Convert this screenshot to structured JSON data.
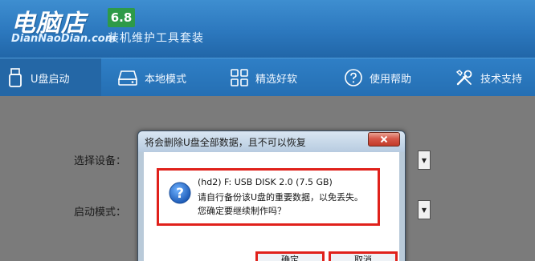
{
  "app": {
    "logo_cn": "电脑店",
    "logo_en": "DianNaoDian.com",
    "version": "6.8",
    "subtitle": "装机维护工具套装"
  },
  "nav": {
    "items": [
      {
        "label": "U盘启动",
        "icon": "usb-drive-icon"
      },
      {
        "label": "本地模式",
        "icon": "hard-disk-icon"
      },
      {
        "label": "精选好软",
        "icon": "grid-apps-icon"
      },
      {
        "label": "使用帮助",
        "icon": "help-circle-icon"
      },
      {
        "label": "技术支持",
        "icon": "tools-icon"
      }
    ],
    "active_index": 0
  },
  "form": {
    "device_label": "选择设备：",
    "mode_label": "启动模式："
  },
  "dialog": {
    "title": "将会删除U盘全部数据，且不可以恢复",
    "icon": "question-icon",
    "lines": [
      "(hd2) F: USB DISK 2.0 (7.5 GB)",
      "请自行备份该U盘的重要数据，以免丢失。",
      "您确定要继续制作吗？"
    ],
    "ok_label": "确定",
    "cancel_label": "取消"
  },
  "colors": {
    "header_blue": "#2c78be",
    "highlight_red": "#e0211b",
    "version_badge": "#2e9a48"
  }
}
